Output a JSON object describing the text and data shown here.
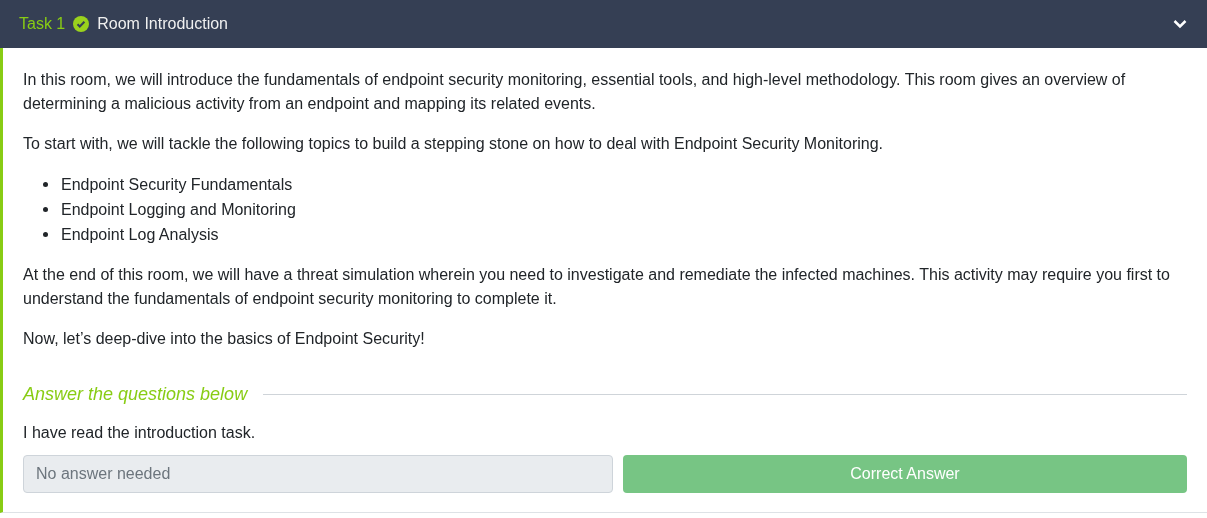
{
  "task": {
    "number": "Task 1",
    "completed": true,
    "title": "Room Introduction",
    "expanded": true
  },
  "paragraphs_before": [
    "In this room, we will introduce the fundamentals of endpoint security monitoring, essential tools, and high-level methodology. This room gives an overview of determining a malicious activity from an endpoint and mapping its related events.",
    "To start with, we will tackle the following topics to build a stepping stone on how to deal with Endpoint Security Monitoring."
  ],
  "topics": [
    "Endpoint Security Fundamentals",
    "Endpoint Logging and Monitoring",
    "Endpoint Log Analysis"
  ],
  "paragraphs_after": [
    "At the end of this room, we will have a threat simulation wherein you need to investigate and remediate the infected machines. This activity may require you first to understand the fundamentals of endpoint security monitoring to complete it.",
    "Now, let’s deep-dive into the basics of Endpoint Security!"
  ],
  "questions_heading": "Answer the questions below",
  "questions": [
    {
      "prompt": "I have read the introduction task.",
      "placeholder": "No answer needed",
      "disabled": true,
      "button": "Correct Answer"
    }
  ]
}
